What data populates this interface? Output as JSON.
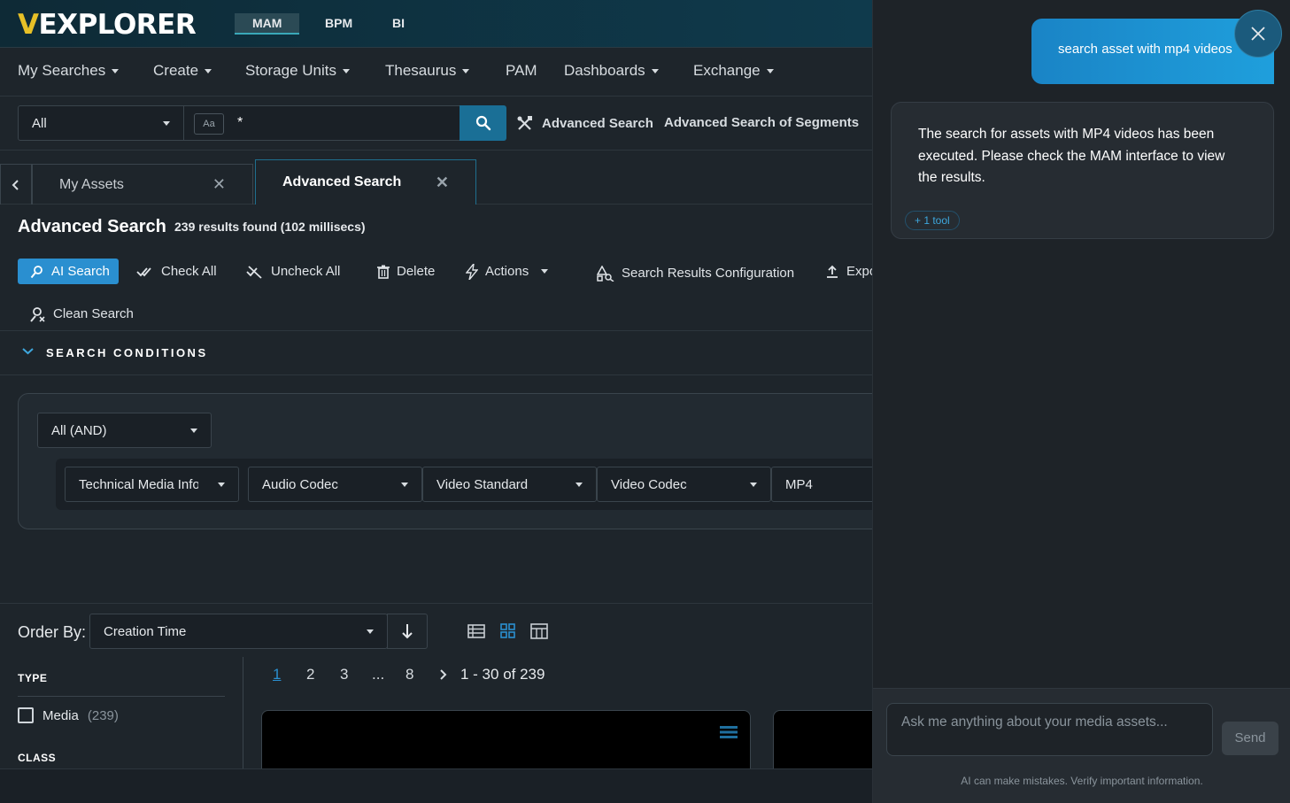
{
  "topbar": {
    "logo_v": "V",
    "logo_rest": "EXPLORER",
    "apps": [
      "MAM",
      "BPM",
      "BI"
    ],
    "active_app": "MAM"
  },
  "menu": {
    "items": [
      {
        "label": "My Searches",
        "dropdown": true
      },
      {
        "label": "Create",
        "dropdown": true
      },
      {
        "label": "Storage Units",
        "dropdown": true
      },
      {
        "label": "Thesaurus",
        "dropdown": true
      },
      {
        "label": "PAM",
        "dropdown": false
      },
      {
        "label": "Dashboards",
        "dropdown": true
      },
      {
        "label": "Exchange",
        "dropdown": true
      }
    ]
  },
  "search": {
    "scope": "All",
    "case_toggle": "Aa",
    "query": "*",
    "advanced_link": "Advanced Search",
    "segments_link": "Advanced Search of Segments"
  },
  "tabs": [
    {
      "label": "My Assets",
      "active": false
    },
    {
      "label": "Advanced Search",
      "active": true
    }
  ],
  "page": {
    "title": "Advanced Search",
    "results_info": "239 results found (102 millisecs)"
  },
  "toolbar": {
    "ai_search": "AI Search",
    "check_all": "Check All",
    "uncheck_all": "Uncheck All",
    "delete": "Delete",
    "actions": "Actions",
    "results_config": "Search Results Configuration",
    "export": "Expo",
    "clean_search": "Clean Search"
  },
  "conditions": {
    "title": "SEARCH CONDITIONS",
    "operator": "All (AND)",
    "fields": [
      "Technical Media Info",
      "Audio Codec",
      "Video Standard",
      "Video Codec",
      "MP4"
    ]
  },
  "order": {
    "label": "Order By:",
    "value": "Creation Time"
  },
  "facets": {
    "type_heading": "TYPE",
    "type_item_label": "Media",
    "type_item_count": "(239)",
    "class_heading": "CLASS"
  },
  "pager": {
    "pages": [
      "1",
      "2",
      "3",
      "...",
      "8"
    ],
    "active_page": "1",
    "range": "1 - 30 of 239"
  },
  "chat": {
    "user_message": "search asset with mp4 videos",
    "ai_message": "The search for assets with MP4 videos has been executed. Please check the MAM interface to view the results.",
    "tool_badge": "+ 1 tool",
    "input_placeholder": "Ask me anything about your media assets...",
    "send_label": "Send",
    "disclaimer": "AI can make mistakes. Verify important information."
  },
  "colors": {
    "accent": "#2a8fd0",
    "logo_accent": "#e7c027",
    "chat_bubble": "#1f9fdc"
  }
}
